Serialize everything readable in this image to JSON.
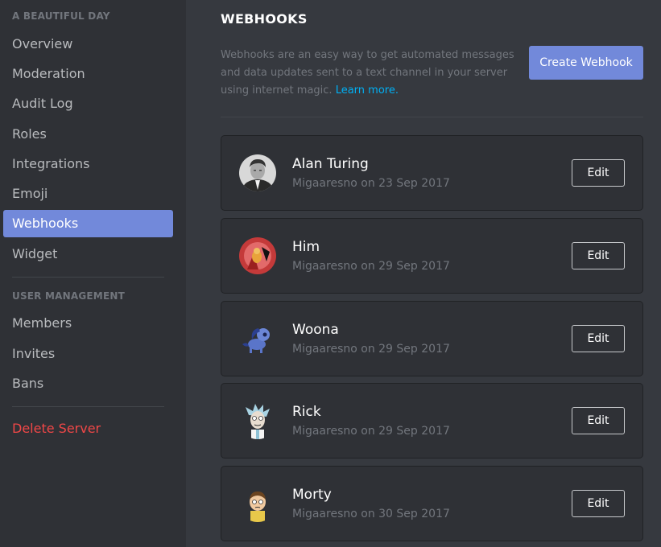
{
  "sidebar": {
    "server_header": "A BEAUTIFUL DAY",
    "items": [
      {
        "label": "Overview"
      },
      {
        "label": "Moderation"
      },
      {
        "label": "Audit Log"
      },
      {
        "label": "Roles"
      },
      {
        "label": "Integrations"
      },
      {
        "label": "Emoji"
      },
      {
        "label": "Webhooks",
        "active": true
      },
      {
        "label": "Widget"
      }
    ],
    "user_header": "USER MANAGEMENT",
    "user_items": [
      {
        "label": "Members"
      },
      {
        "label": "Invites"
      },
      {
        "label": "Bans"
      }
    ],
    "delete_label": "Delete Server"
  },
  "main": {
    "title": "WEBHOOKS",
    "description": "Webhooks are an easy way to get automated messages and data updates sent to a text channel in your server using internet magic.",
    "learn_more": "Learn more.",
    "create_button": "Create Webhook",
    "edit_label": "Edit",
    "webhooks": [
      {
        "name": "Alan Turing",
        "meta": "Migaaresno on 23 Sep 2017",
        "avatar_icon": "alan-turing-portrait-icon"
      },
      {
        "name": "Him",
        "meta": "Migaaresno on 29 Sep 2017",
        "avatar_icon": "him-character-icon"
      },
      {
        "name": "Woona",
        "meta": "Migaaresno on 29 Sep 2017",
        "avatar_icon": "woona-pony-icon"
      },
      {
        "name": "Rick",
        "meta": "Migaaresno on 29 Sep 2017",
        "avatar_icon": "rick-character-icon"
      },
      {
        "name": "Morty",
        "meta": "Migaaresno on 30 Sep 2017",
        "avatar_icon": "morty-character-icon"
      }
    ]
  },
  "colors": {
    "accent": "#7289da",
    "danger": "#f04747",
    "link": "#00b0f4"
  }
}
